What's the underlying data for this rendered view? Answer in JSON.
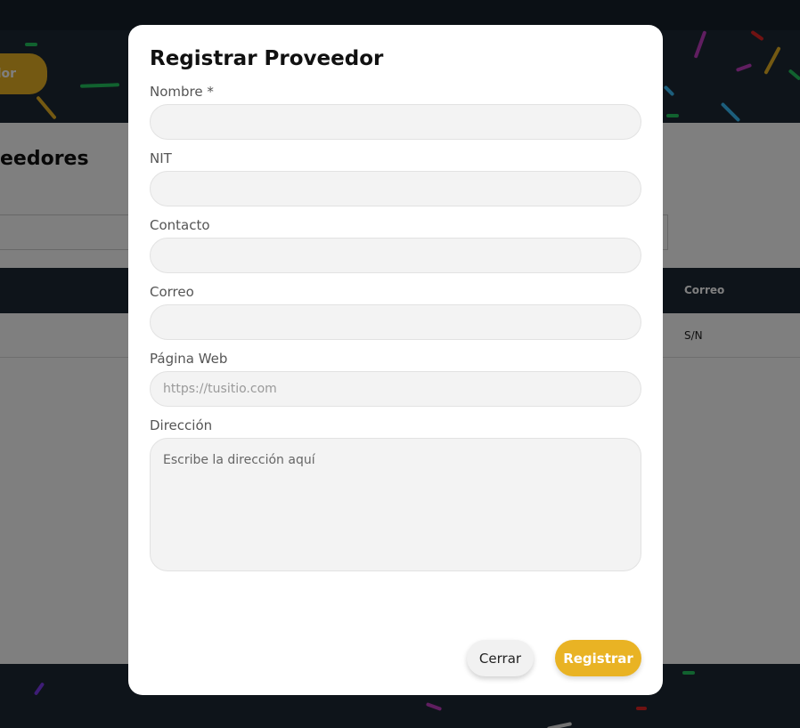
{
  "background": {
    "hero_button_label": "dor",
    "page_title": "eedores",
    "table": {
      "columns": [
        "Correo"
      ],
      "rows": [
        [
          "S/N"
        ]
      ]
    }
  },
  "modal": {
    "title": "Registrar Proveedor",
    "fields": {
      "nombre": {
        "label": "Nombre *",
        "value": "",
        "placeholder": ""
      },
      "nit": {
        "label": "NIT",
        "value": "",
        "placeholder": ""
      },
      "contacto": {
        "label": "Contacto",
        "value": "",
        "placeholder": ""
      },
      "correo": {
        "label": "Correo",
        "value": "",
        "placeholder": ""
      },
      "pagina_web": {
        "label": "Página Web",
        "value": "",
        "placeholder": "https://tusitio.com"
      },
      "direccion": {
        "label": "Dirección",
        "value": "",
        "placeholder": "Escribe la dirección aquí"
      }
    },
    "buttons": {
      "close_label": "Cerrar",
      "submit_label": "Registrar"
    }
  },
  "colors": {
    "accent": "#e9b324",
    "dark_header": "#1c2835",
    "overlay": "rgba(0,0,0,0.5)"
  }
}
